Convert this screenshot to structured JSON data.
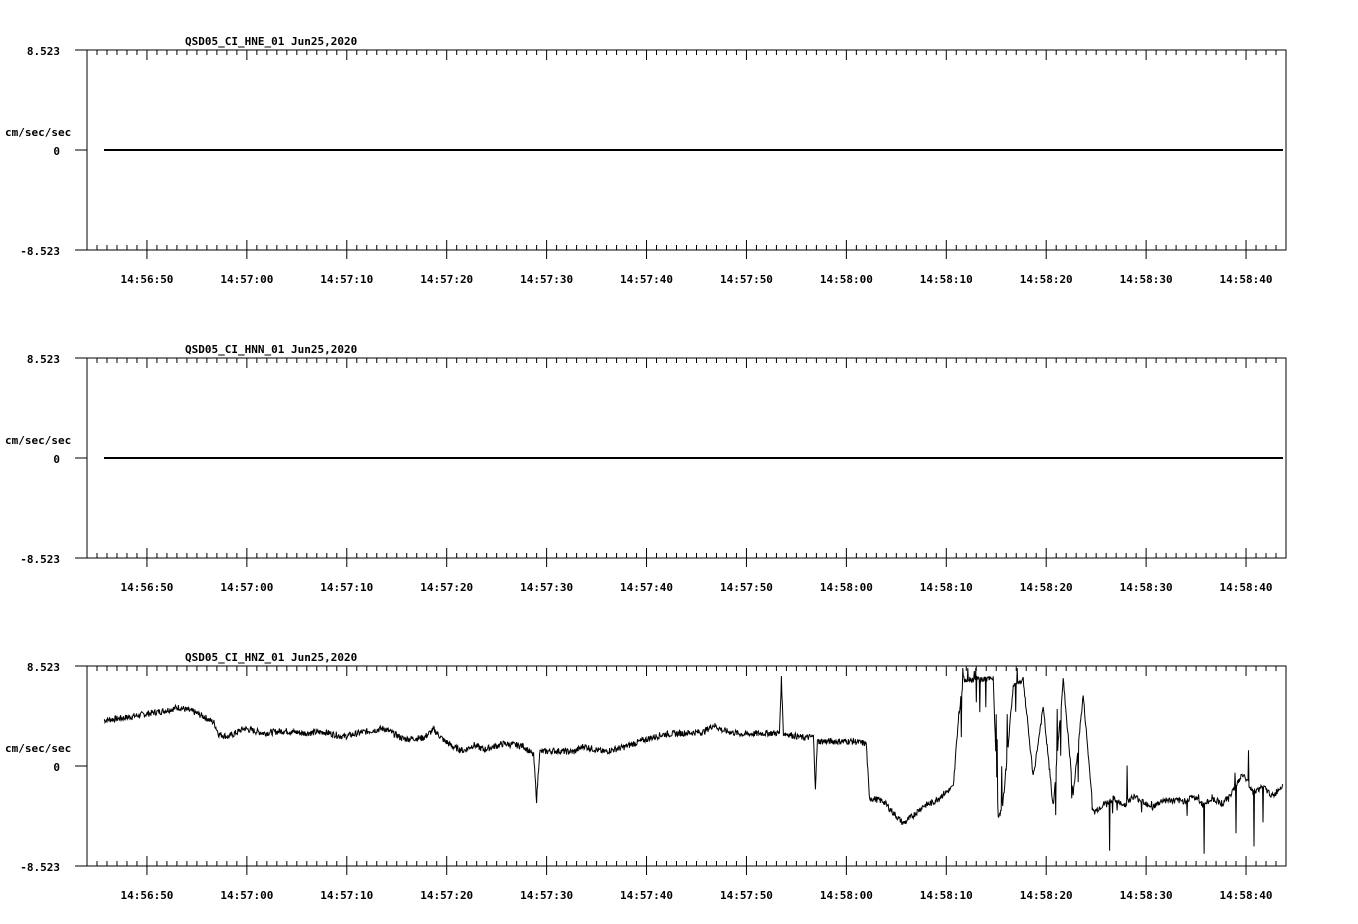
{
  "ylabel": "cm/sec/sec",
  "x_tick_labels": [
    "14:56:50",
    "14:57:00",
    "14:57:10",
    "14:57:20",
    "14:57:30",
    "14:57:40",
    "14:57:50",
    "14:58:00",
    "14:58:10",
    "14:58:20",
    "14:58:30",
    "14:58:40"
  ],
  "chart_data": [
    {
      "type": "line",
      "title": "QSD05_CI_HNE_01  Jun25,2020",
      "ylabel": "cm/sec/sec",
      "ylim": [
        -8.523,
        8.523
      ],
      "y_tick_labels": [
        "8.523",
        "0",
        "-8.523"
      ],
      "x_range": [
        "14:56:44",
        "14:58:44"
      ],
      "series": [
        {
          "values": [
            [
              0,
              0
            ],
            [
              118,
              0
            ]
          ]
        }
      ]
    },
    {
      "type": "line",
      "title": "QSD05_CI_HNN_01  Jun25,2020",
      "ylabel": "cm/sec/sec",
      "ylim": [
        -8.523,
        8.523
      ],
      "y_tick_labels": [
        "8.523",
        "0",
        "-8.523"
      ],
      "x_range": [
        "14:56:44",
        "14:58:44"
      ],
      "series": [
        {
          "values": [
            [
              0,
              0
            ],
            [
              118,
              0
            ]
          ]
        }
      ]
    },
    {
      "type": "line",
      "title": "QSD05_CI_HNZ_01  Jun25,2020",
      "ylabel": "cm/sec/sec",
      "ylim": [
        -8.523,
        8.523
      ],
      "y_tick_labels": [
        "8.523",
        "0",
        "-8.523"
      ],
      "x_range": [
        "14:56:44",
        "14:58:44"
      ],
      "series": [
        {
          "values": [
            [
              0,
              3.9
            ],
            [
              2,
              4.1
            ],
            [
              4,
              4.4
            ],
            [
              6,
              4.7
            ],
            [
              7.5,
              5.0
            ],
            [
              9,
              4.6
            ],
            [
              10,
              4.2
            ],
            [
              11,
              3.7
            ],
            [
              11.5,
              2.7
            ],
            [
              12.5,
              2.5
            ],
            [
              14,
              3.2
            ],
            [
              16,
              2.8
            ],
            [
              18,
              3.0
            ],
            [
              20,
              2.8
            ],
            [
              22,
              2.9
            ],
            [
              24,
              2.5
            ],
            [
              26,
              2.9
            ],
            [
              28,
              3.2
            ],
            [
              30,
              2.3
            ],
            [
              32,
              2.4
            ],
            [
              33,
              3.1
            ],
            [
              34,
              2.2
            ],
            [
              35,
              1.6
            ],
            [
              36,
              1.3
            ],
            [
              37,
              1.8
            ],
            [
              38,
              1.4
            ],
            [
              40,
              1.9
            ],
            [
              42,
              1.7
            ],
            [
              43,
              0.9
            ],
            [
              43.3,
              -2.9
            ],
            [
              43.6,
              1.2
            ],
            [
              45,
              1.3
            ],
            [
              47,
              1.2
            ],
            [
              48,
              1.7
            ],
            [
              50,
              1.2
            ],
            [
              52,
              1.6
            ],
            [
              54,
              2.2
            ],
            [
              56,
              2.7
            ],
            [
              58,
              2.8
            ],
            [
              60,
              2.9
            ],
            [
              61,
              3.5
            ],
            [
              62,
              3.0
            ],
            [
              64,
              2.7
            ],
            [
              66,
              2.8
            ],
            [
              67.6,
              2.8
            ],
            [
              67.8,
              7.4
            ],
            [
              68,
              2.8
            ],
            [
              70,
              2.4
            ],
            [
              71,
              2.5
            ],
            [
              71.2,
              -1.8
            ],
            [
              71.4,
              2.1
            ],
            [
              73,
              2.1
            ],
            [
              75,
              2.1
            ],
            [
              76.3,
              1.9
            ],
            [
              76.6,
              -2.7
            ],
            [
              78,
              -3.0
            ],
            [
              79,
              -4.0
            ],
            [
              80,
              -4.9
            ],
            [
              81,
              -4.2
            ],
            [
              82,
              -3.4
            ],
            [
              83,
              -3.1
            ],
            [
              84,
              -2.4
            ],
            [
              85,
              -1.8
            ],
            [
              85.5,
              4.0
            ],
            [
              86,
              7.4
            ],
            [
              87,
              7.4
            ],
            [
              88,
              7.4
            ],
            [
              89,
              7.4
            ],
            [
              89.5,
              -4.5
            ],
            [
              90,
              -3.0
            ],
            [
              91,
              6.8
            ],
            [
              92,
              7.4
            ],
            [
              93,
              -1.0
            ],
            [
              94,
              5.0
            ],
            [
              95,
              -3.5
            ],
            [
              96,
              7.4
            ],
            [
              97,
              -2.5
            ],
            [
              98,
              6.0
            ],
            [
              99,
              -4.0
            ],
            [
              100,
              -3.3
            ],
            [
              101,
              -2.8
            ],
            [
              102,
              -3.4
            ],
            [
              103,
              -2.6
            ],
            [
              104,
              -3.0
            ],
            [
              105,
              -3.5
            ],
            [
              106,
              -2.9
            ],
            [
              108,
              -3.0
            ],
            [
              109,
              -2.6
            ],
            [
              110,
              -3.3
            ],
            [
              111,
              -2.8
            ],
            [
              112,
              -3.2
            ],
            [
              113,
              -2.1
            ],
            [
              114,
              -0.7
            ],
            [
              115,
              -2.2
            ],
            [
              116,
              -1.8
            ],
            [
              117,
              -2.6
            ],
            [
              118,
              -1.5
            ]
          ]
        }
      ]
    }
  ]
}
